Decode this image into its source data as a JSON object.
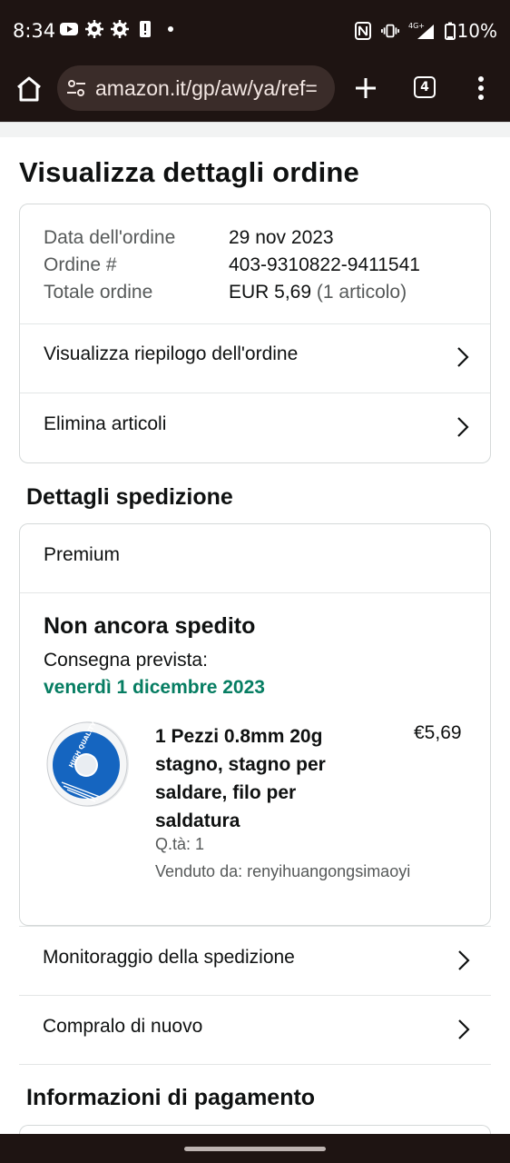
{
  "status_bar": {
    "time": "8:34",
    "battery": "10%",
    "network": "4G+"
  },
  "browser": {
    "url": "amazon.it/gp/aw/ya/ref=",
    "tab_count": "4"
  },
  "page": {
    "title": "Visualizza dettagli ordine"
  },
  "order_summary": {
    "date_label": "Data dell'ordine",
    "date_value": "29 nov 2023",
    "number_label": "Ordine #",
    "number_value": "403-9310822-9411541",
    "total_label": "Totale ordine",
    "total_value": "EUR 5,69",
    "total_items": "(1 articolo)",
    "view_summary_label": "Visualizza riepilogo dell'ordine",
    "delete_items_label": "Elimina articoli"
  },
  "shipping": {
    "section_title": "Dettagli spedizione",
    "service": "Premium",
    "status": "Non ancora spedito",
    "delivery_label": "Consegna prevista:",
    "delivery_date": "venerdì 1 dicembre 2023",
    "item": {
      "title": "1 Pezzi 0.8mm 20g stagno, stagno per saldare, filo per saldatura",
      "price": "€5,69",
      "qty": "Q.tà: 1",
      "seller": "Venduto da: renyihuangongsimaoyi",
      "image_text": "HIGH QUALITY"
    },
    "track_label": "Monitoraggio della spedizione",
    "buy_again_label": "Compralo di nuovo"
  },
  "payment": {
    "section_title": "Informazioni di pagamento"
  },
  "colors": {
    "delivery_green": "#067d62",
    "browser_chrome": "#1e1412"
  }
}
